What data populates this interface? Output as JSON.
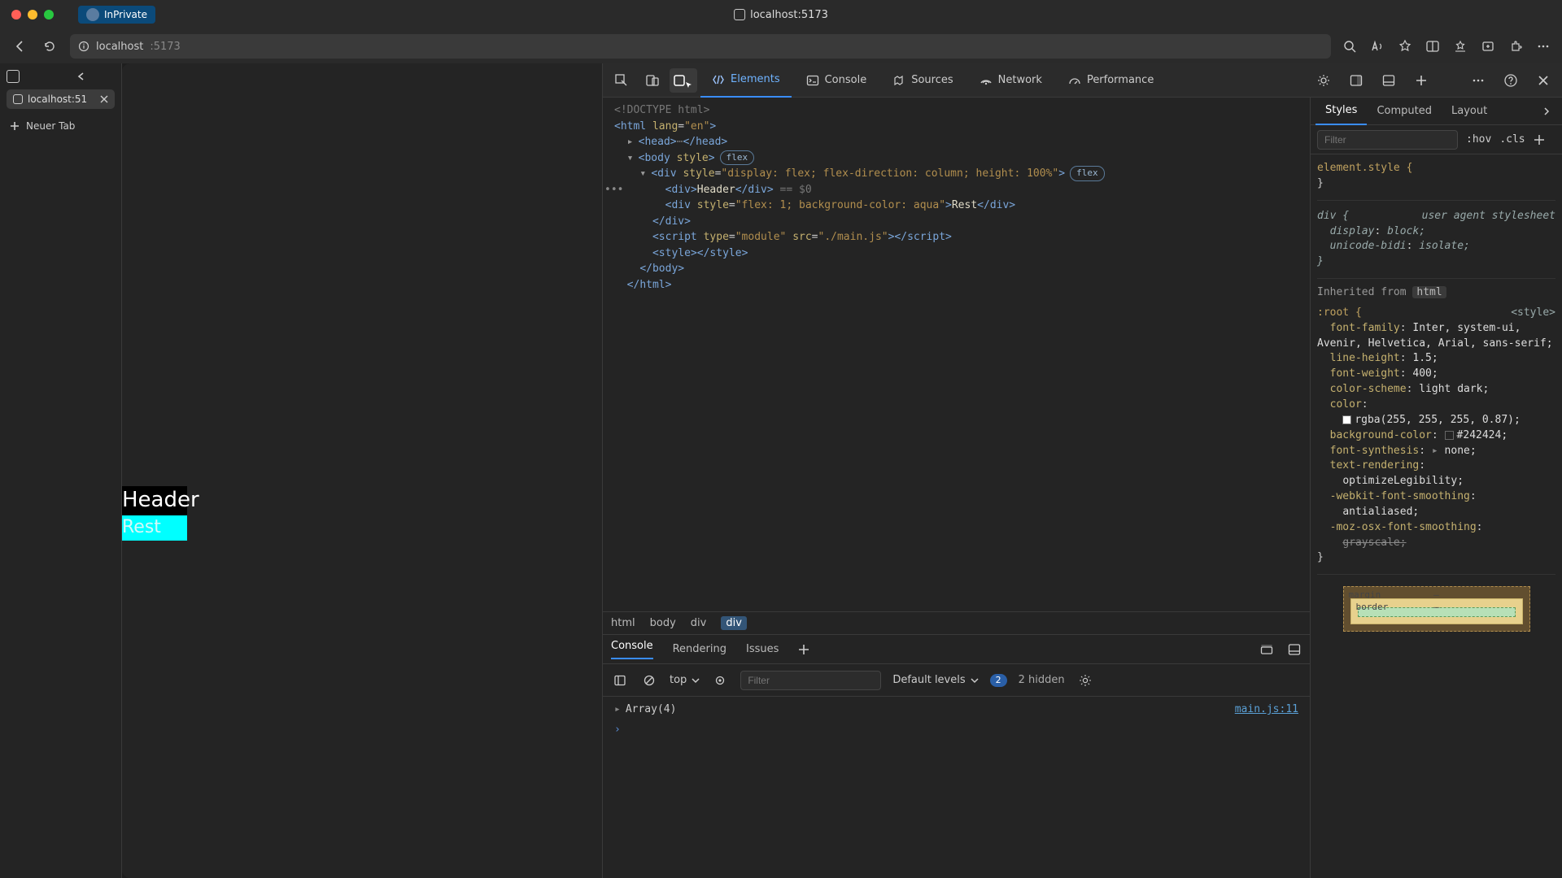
{
  "window": {
    "inprivate_label": "InPrivate",
    "title": "localhost:5173"
  },
  "address": {
    "host": "localhost",
    "port": ":5173"
  },
  "sidebar": {
    "tab_label": "localhost:51",
    "new_tab_label": "Neuer Tab"
  },
  "page": {
    "header": "Header",
    "rest": "Rest"
  },
  "devtools": {
    "tabs": {
      "elements": "Elements",
      "console": "Console",
      "sources": "Sources",
      "network": "Network",
      "performance": "Performance"
    },
    "dom": {
      "doctype": "<!DOCTYPE html>",
      "html_open": "<html lang=\"en\">",
      "head": "<head>…</head>",
      "body_open": "<body style>",
      "flex_pill": "flex",
      "div_outer": "<div style=\"display: flex; flex-direction: column; height: 100%\">",
      "div_header_open": "<div>",
      "div_header_text": "Header",
      "div_header_close": "</div>",
      "selected_suffix": " == $0",
      "div_rest": "<div style=\"flex: 1; background-color: aqua\">Rest</div>",
      "div_outer_close": "</div>",
      "script_line": "<script type=\"module\" src=\"./main.js\"></script>",
      "style_line": "<style></style>",
      "body_close": "</body>",
      "html_close": "</html>",
      "dots": "•••"
    },
    "crumbs": [
      "html",
      "body",
      "div",
      "div"
    ]
  },
  "drawer": {
    "tabs": {
      "console": "Console",
      "rendering": "Rendering",
      "issues": "Issues"
    },
    "toolbar": {
      "context": "top",
      "filter_placeholder": "Filter",
      "levels": "Default levels",
      "issues_count": "2",
      "hidden": "2 hidden"
    },
    "log": {
      "line1": "Array(4)",
      "src1": "main.js:11"
    }
  },
  "styles": {
    "tabs": {
      "styles": "Styles",
      "computed": "Computed",
      "layout": "Layout"
    },
    "filter_placeholder": "Filter",
    "hov": ":hov",
    "cls": ".cls",
    "element_style_sel": "element.style {",
    "element_style_close": "}",
    "div_sel": "div {",
    "ua_note": "user agent stylesheet",
    "div_rules": [
      {
        "prop": "display",
        "val": "block;"
      },
      {
        "prop": "unicode-bidi",
        "val": "isolate;"
      }
    ],
    "inherited_label": "Inherited from",
    "inherited_from": "html",
    "root_sel": ":root {",
    "root_note": "<style>",
    "root_rules": [
      {
        "prop": "font-family",
        "val": "Inter, system-ui, Avenir, Helvetica, Arial, sans-serif;"
      },
      {
        "prop": "line-height",
        "val": "1.5;"
      },
      {
        "prop": "font-weight",
        "val": "400;"
      },
      {
        "prop": "color-scheme",
        "val": "light dark;"
      },
      {
        "prop": "color",
        "val": "",
        "swatch": "#ffffff",
        "tail": "rgba(255, 255, 255, 0.87);"
      },
      {
        "prop": "background-color",
        "val": "",
        "swatch": "#242424",
        "tail": "#242424;"
      },
      {
        "prop": "font-synthesis",
        "val": "none;",
        "caret": true
      },
      {
        "prop": "text-rendering",
        "val": "optimizeLegibility;"
      },
      {
        "prop": "-webkit-font-smoothing",
        "val": "antialiased;"
      },
      {
        "prop": "-moz-osx-font-smoothing",
        "val": "grayscale;",
        "strike": true
      }
    ],
    "box_model": {
      "margin": "margin",
      "border": "border",
      "dash": "–"
    }
  }
}
